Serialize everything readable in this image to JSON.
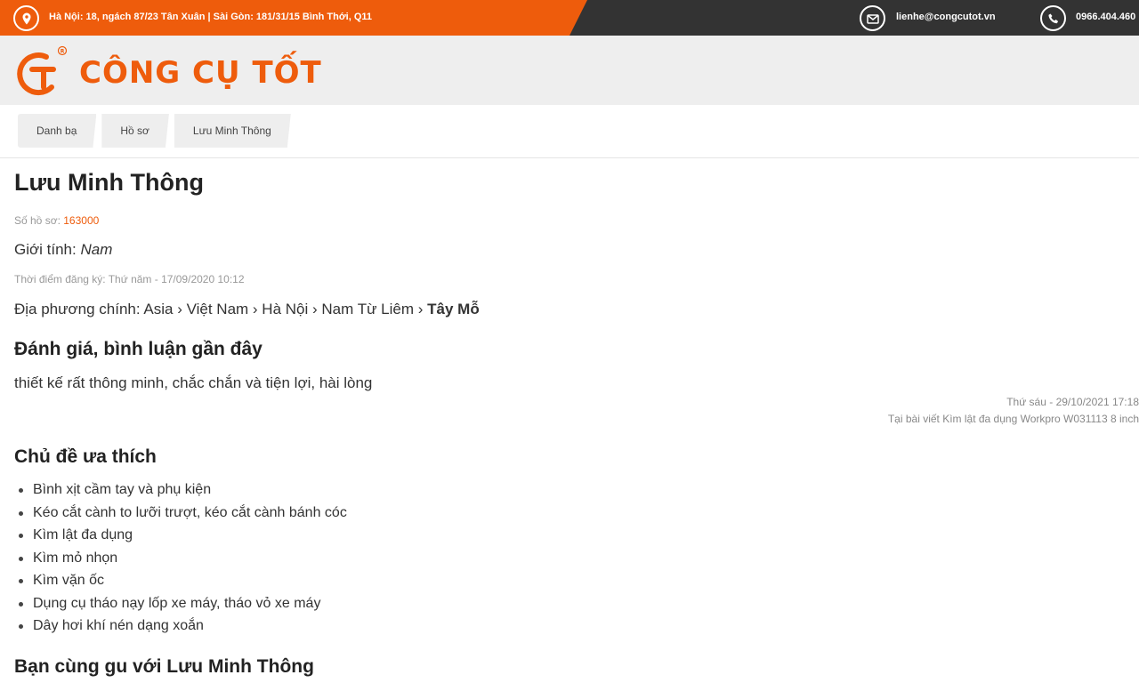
{
  "topbar": {
    "address": "Hà Nội: 18, ngách 87/23 Tân Xuân | Sài Gòn: 181/31/15 Bình Thới, Q11",
    "email": "lienhe@congcutot.vn",
    "phone": "0966.404.460",
    "icons": [
      "location-pin-icon",
      "mail-icon",
      "phone-icon"
    ]
  },
  "logo": {
    "text": "CÔNG CỤ TỐT",
    "mark": "GT®"
  },
  "breadcrumb": [
    "Danh bạ",
    "Hồ sơ",
    "Lưu Minh Thông"
  ],
  "profile": {
    "name": "Lưu Minh Thông",
    "record_label": "Số hồ sơ:",
    "record_number": "163000",
    "gender_label": "Giới tính:",
    "gender": "Nam",
    "registered": "Thời điểm đăng ký: Thứ năm - 17/09/2020 10:12",
    "location_label": "Địa phương chính:",
    "location_path": "Asia › Việt Nam › Hà Nội › Nam Từ Liêm ›",
    "location_last": "Tây Mỗ"
  },
  "reviews": {
    "heading": "Đánh giá, bình luận gần đây",
    "items": [
      {
        "text": "thiết kế rất thông minh, chắc chắn và tiện lợi, hài lòng",
        "date": "Thứ sáu - 29/10/2021 17:18",
        "article": "Tại bài viết Kìm lật đa dụng Workpro W031113 8 inch"
      }
    ]
  },
  "topics": {
    "heading": "Chủ đề ưa thích",
    "items": [
      "Bình xịt cầm tay và phụ kiện",
      "Kéo cắt cành to lưỡi trượt, kéo cắt cành bánh cóc",
      "Kìm lật đa dụng",
      "Kìm mỏ nhọn",
      "Kìm vặn ốc",
      "Dụng cụ tháo nạy lốp xe máy, tháo vỏ xe máy",
      "Dây hơi khí nén dạng xoắn"
    ]
  },
  "similar": {
    "heading": "Bạn cùng gu với Lưu Minh Thông"
  },
  "colors": {
    "brand": "#ee5c0c",
    "topbar_dark": "#333333",
    "header_bg": "#eeeeee"
  }
}
